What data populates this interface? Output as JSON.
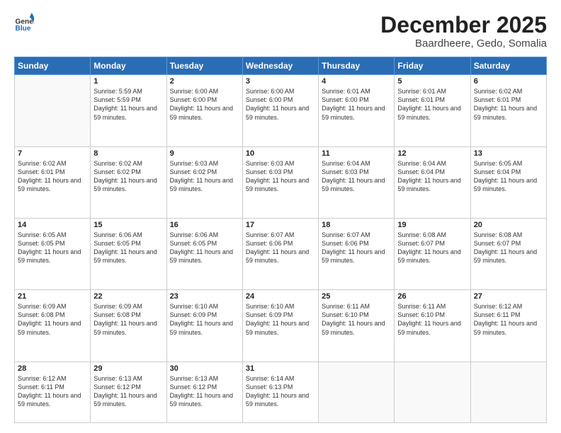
{
  "header": {
    "logo_general": "General",
    "logo_blue": "Blue",
    "month": "December 2025",
    "location": "Baardheere, Gedo, Somalia"
  },
  "weekdays": [
    "Sunday",
    "Monday",
    "Tuesday",
    "Wednesday",
    "Thursday",
    "Friday",
    "Saturday"
  ],
  "weeks": [
    [
      {
        "day": "",
        "empty": true
      },
      {
        "day": "1",
        "sunrise": "Sunrise: 5:59 AM",
        "sunset": "Sunset: 5:59 PM",
        "daylight": "Daylight: 11 hours and 59 minutes."
      },
      {
        "day": "2",
        "sunrise": "Sunrise: 6:00 AM",
        "sunset": "Sunset: 6:00 PM",
        "daylight": "Daylight: 11 hours and 59 minutes."
      },
      {
        "day": "3",
        "sunrise": "Sunrise: 6:00 AM",
        "sunset": "Sunset: 6:00 PM",
        "daylight": "Daylight: 11 hours and 59 minutes."
      },
      {
        "day": "4",
        "sunrise": "Sunrise: 6:01 AM",
        "sunset": "Sunset: 6:00 PM",
        "daylight": "Daylight: 11 hours and 59 minutes."
      },
      {
        "day": "5",
        "sunrise": "Sunrise: 6:01 AM",
        "sunset": "Sunset: 6:01 PM",
        "daylight": "Daylight: 11 hours and 59 minutes."
      },
      {
        "day": "6",
        "sunrise": "Sunrise: 6:02 AM",
        "sunset": "Sunset: 6:01 PM",
        "daylight": "Daylight: 11 hours and 59 minutes."
      }
    ],
    [
      {
        "day": "7",
        "sunrise": "Sunrise: 6:02 AM",
        "sunset": "Sunset: 6:01 PM",
        "daylight": "Daylight: 11 hours and 59 minutes."
      },
      {
        "day": "8",
        "sunrise": "Sunrise: 6:02 AM",
        "sunset": "Sunset: 6:02 PM",
        "daylight": "Daylight: 11 hours and 59 minutes."
      },
      {
        "day": "9",
        "sunrise": "Sunrise: 6:03 AM",
        "sunset": "Sunset: 6:02 PM",
        "daylight": "Daylight: 11 hours and 59 minutes."
      },
      {
        "day": "10",
        "sunrise": "Sunrise: 6:03 AM",
        "sunset": "Sunset: 6:03 PM",
        "daylight": "Daylight: 11 hours and 59 minutes."
      },
      {
        "day": "11",
        "sunrise": "Sunrise: 6:04 AM",
        "sunset": "Sunset: 6:03 PM",
        "daylight": "Daylight: 11 hours and 59 minutes."
      },
      {
        "day": "12",
        "sunrise": "Sunrise: 6:04 AM",
        "sunset": "Sunset: 6:04 PM",
        "daylight": "Daylight: 11 hours and 59 minutes."
      },
      {
        "day": "13",
        "sunrise": "Sunrise: 6:05 AM",
        "sunset": "Sunset: 6:04 PM",
        "daylight": "Daylight: 11 hours and 59 minutes."
      }
    ],
    [
      {
        "day": "14",
        "sunrise": "Sunrise: 6:05 AM",
        "sunset": "Sunset: 6:05 PM",
        "daylight": "Daylight: 11 hours and 59 minutes."
      },
      {
        "day": "15",
        "sunrise": "Sunrise: 6:06 AM",
        "sunset": "Sunset: 6:05 PM",
        "daylight": "Daylight: 11 hours and 59 minutes."
      },
      {
        "day": "16",
        "sunrise": "Sunrise: 6:06 AM",
        "sunset": "Sunset: 6:05 PM",
        "daylight": "Daylight: 11 hours and 59 minutes."
      },
      {
        "day": "17",
        "sunrise": "Sunrise: 6:07 AM",
        "sunset": "Sunset: 6:06 PM",
        "daylight": "Daylight: 11 hours and 59 minutes."
      },
      {
        "day": "18",
        "sunrise": "Sunrise: 6:07 AM",
        "sunset": "Sunset: 6:06 PM",
        "daylight": "Daylight: 11 hours and 59 minutes."
      },
      {
        "day": "19",
        "sunrise": "Sunrise: 6:08 AM",
        "sunset": "Sunset: 6:07 PM",
        "daylight": "Daylight: 11 hours and 59 minutes."
      },
      {
        "day": "20",
        "sunrise": "Sunrise: 6:08 AM",
        "sunset": "Sunset: 6:07 PM",
        "daylight": "Daylight: 11 hours and 59 minutes."
      }
    ],
    [
      {
        "day": "21",
        "sunrise": "Sunrise: 6:09 AM",
        "sunset": "Sunset: 6:08 PM",
        "daylight": "Daylight: 11 hours and 59 minutes."
      },
      {
        "day": "22",
        "sunrise": "Sunrise: 6:09 AM",
        "sunset": "Sunset: 6:08 PM",
        "daylight": "Daylight: 11 hours and 59 minutes."
      },
      {
        "day": "23",
        "sunrise": "Sunrise: 6:10 AM",
        "sunset": "Sunset: 6:09 PM",
        "daylight": "Daylight: 11 hours and 59 minutes."
      },
      {
        "day": "24",
        "sunrise": "Sunrise: 6:10 AM",
        "sunset": "Sunset: 6:09 PM",
        "daylight": "Daylight: 11 hours and 59 minutes."
      },
      {
        "day": "25",
        "sunrise": "Sunrise: 6:11 AM",
        "sunset": "Sunset: 6:10 PM",
        "daylight": "Daylight: 11 hours and 59 minutes."
      },
      {
        "day": "26",
        "sunrise": "Sunrise: 6:11 AM",
        "sunset": "Sunset: 6:10 PM",
        "daylight": "Daylight: 11 hours and 59 minutes."
      },
      {
        "day": "27",
        "sunrise": "Sunrise: 6:12 AM",
        "sunset": "Sunset: 6:11 PM",
        "daylight": "Daylight: 11 hours and 59 minutes."
      }
    ],
    [
      {
        "day": "28",
        "sunrise": "Sunrise: 6:12 AM",
        "sunset": "Sunset: 6:11 PM",
        "daylight": "Daylight: 11 hours and 59 minutes."
      },
      {
        "day": "29",
        "sunrise": "Sunrise: 6:13 AM",
        "sunset": "Sunset: 6:12 PM",
        "daylight": "Daylight: 11 hours and 59 minutes."
      },
      {
        "day": "30",
        "sunrise": "Sunrise: 6:13 AM",
        "sunset": "Sunset: 6:12 PM",
        "daylight": "Daylight: 11 hours and 59 minutes."
      },
      {
        "day": "31",
        "sunrise": "Sunrise: 6:14 AM",
        "sunset": "Sunset: 6:13 PM",
        "daylight": "Daylight: 11 hours and 59 minutes."
      },
      {
        "day": "",
        "empty": true
      },
      {
        "day": "",
        "empty": true
      },
      {
        "day": "",
        "empty": true
      }
    ]
  ]
}
